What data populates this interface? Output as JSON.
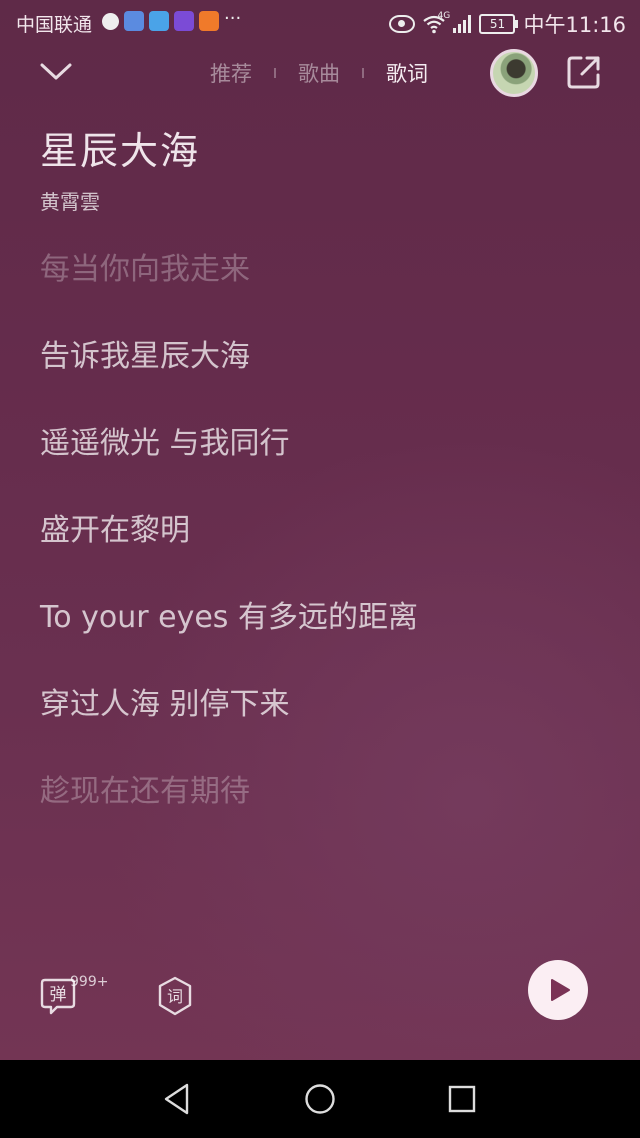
{
  "status_bar": {
    "carrier": "中国联通",
    "more_indicator": "···",
    "battery": "51",
    "network": "4G",
    "time": "中午11:16"
  },
  "nav": {
    "tabs": [
      {
        "label": "推荐",
        "active": false
      },
      {
        "label": "歌曲",
        "active": false
      },
      {
        "label": "歌词",
        "active": true
      }
    ]
  },
  "song": {
    "title": "星辰大海",
    "artist": "黄霄雲"
  },
  "lyrics": [
    {
      "text": "每当你向我走来",
      "state": "faded"
    },
    {
      "text": "告诉我星辰大海",
      "state": "normal"
    },
    {
      "text": "遥遥微光 与我同行",
      "state": "normal"
    },
    {
      "text": "盛开在黎明",
      "state": "normal"
    },
    {
      "text": "To your eyes 有多远的距离",
      "state": "normal"
    },
    {
      "text": "穿过人海 别停下来",
      "state": "normal"
    },
    {
      "text": "趁现在还有期待",
      "state": "faded"
    }
  ],
  "controls": {
    "danmu_label": "弹",
    "danmu_count": "999+",
    "lyric_label": "词"
  },
  "colors": {
    "background_top": "#5f2a48",
    "background_bottom": "#733554",
    "play_button": "#fbeef3",
    "play_icon": "#7a3355"
  }
}
